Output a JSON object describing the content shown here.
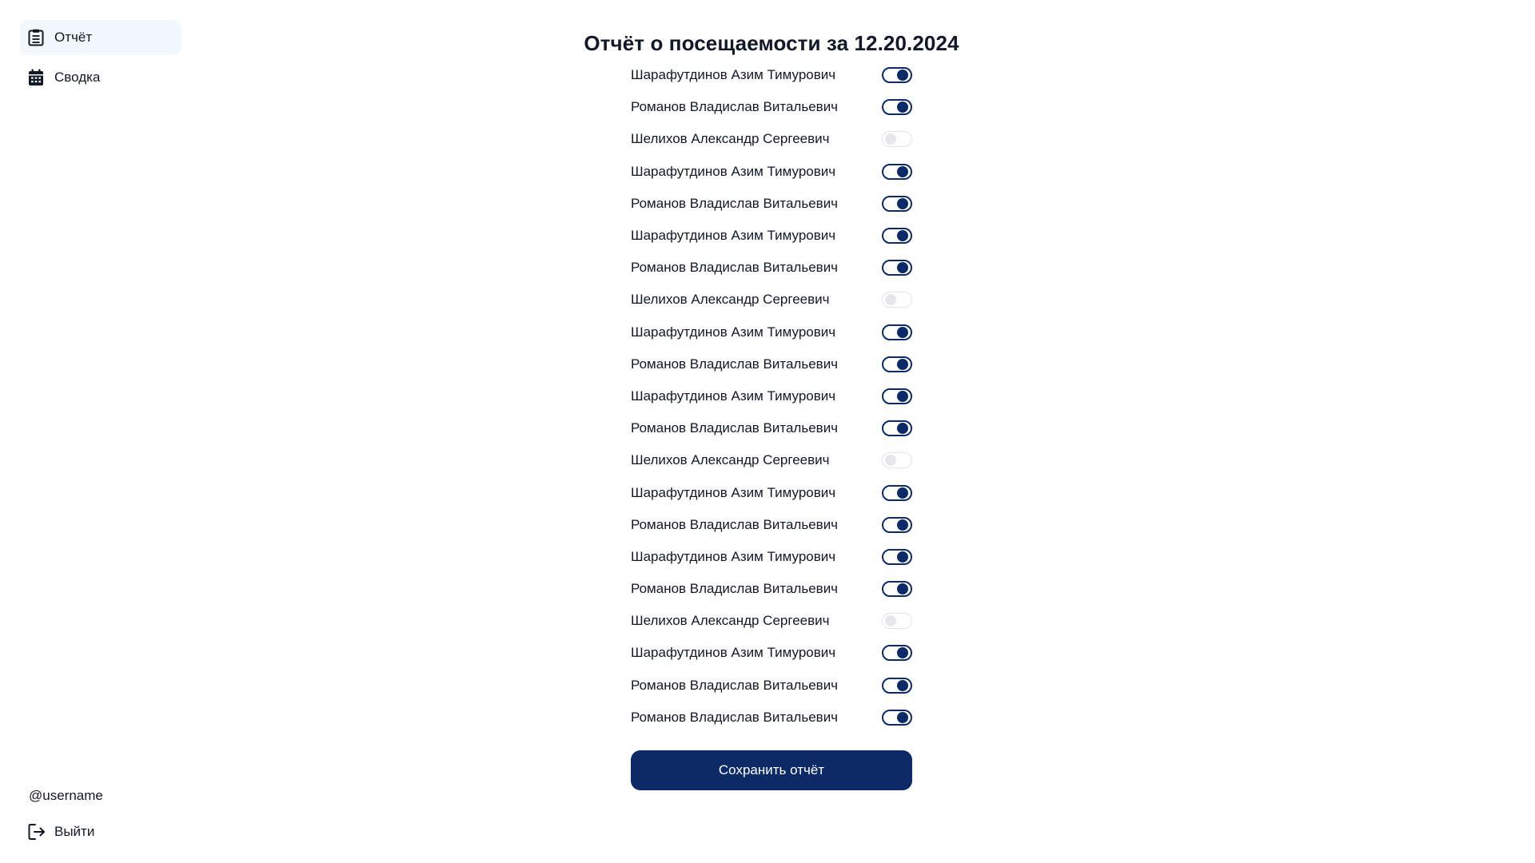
{
  "sidebar": {
    "items": [
      {
        "label": "Отчёт",
        "icon": "clipboard-icon",
        "active": true
      },
      {
        "label": "Сводка",
        "icon": "calendar-icon",
        "active": false
      }
    ],
    "username": "@username",
    "logout_label": "Выйти",
    "logout_icon": "logout-icon"
  },
  "main": {
    "title": "Отчёт о посещаемости за 12.20.2024",
    "rows": [
      {
        "name": "Шарафутдинов Азим Тимурович",
        "present": true
      },
      {
        "name": "Романов Владислав Витальевич",
        "present": true
      },
      {
        "name": "Шелихов Александр Сергеевич",
        "present": false
      },
      {
        "name": "Шарафутдинов Азим Тимурович",
        "present": true
      },
      {
        "name": "Романов Владислав Витальевич",
        "present": true
      },
      {
        "name": "Шарафутдинов Азим Тимурович",
        "present": true
      },
      {
        "name": "Романов Владислав Витальевич",
        "present": true
      },
      {
        "name": "Шелихов Александр Сергеевич",
        "present": false
      },
      {
        "name": "Шарафутдинов Азим Тимурович",
        "present": true
      },
      {
        "name": "Романов Владислав Витальевич",
        "present": true
      },
      {
        "name": "Шарафутдинов Азим Тимурович",
        "present": true
      },
      {
        "name": "Романов Владислав Витальевич",
        "present": true
      },
      {
        "name": "Шелихов Александр Сергеевич",
        "present": false
      },
      {
        "name": "Шарафутдинов Азим Тимурович",
        "present": true
      },
      {
        "name": "Романов Владислав Витальевич",
        "present": true
      },
      {
        "name": "Шарафутдинов Азим Тимурович",
        "present": true
      },
      {
        "name": "Романов Владислав Витальевич",
        "present": true
      },
      {
        "name": "Шелихов Александр Сергеевич",
        "present": false
      },
      {
        "name": "Шарафутдинов Азим Тимурович",
        "present": true
      },
      {
        "name": "Романов Владислав Витальевич",
        "present": true
      },
      {
        "name": "Романов Владислав Витальевич",
        "present": true
      }
    ],
    "save_label": "Сохранить отчёт"
  },
  "colors": {
    "accent": "#0b2a66",
    "active_nav_bg": "#f2f8fd",
    "toggle_off": "#e6e7ea"
  }
}
